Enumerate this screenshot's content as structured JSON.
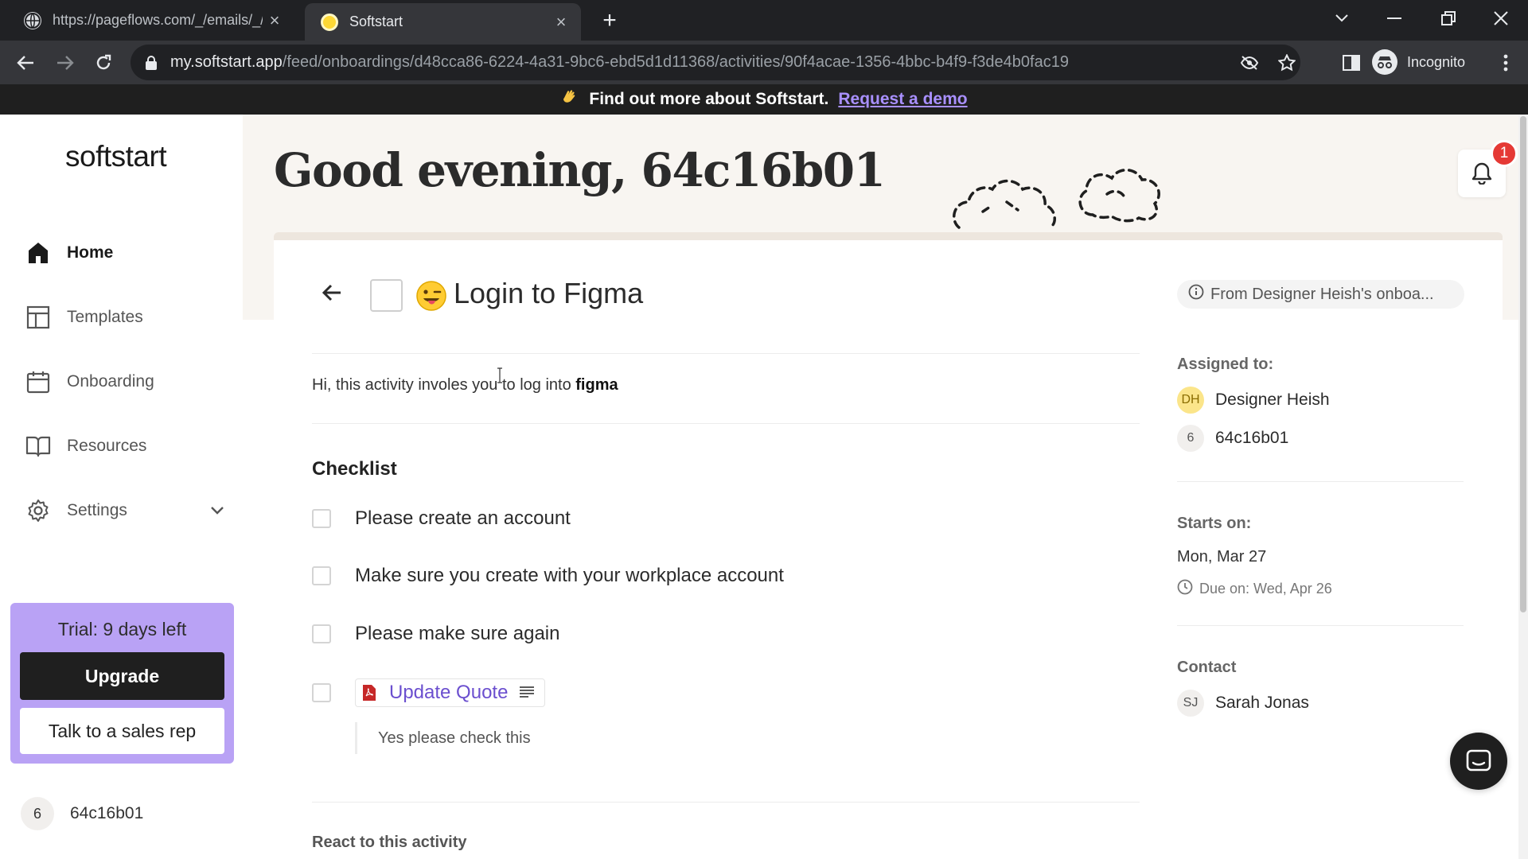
{
  "browser": {
    "tabs": [
      {
        "title": "https://pageflows.com/_/emails/_/",
        "active": false
      },
      {
        "title": "Softstart",
        "active": true
      }
    ],
    "url_host": "my.softstart.app",
    "url_path": "/feed/onboardings/d48cca86-6224-4a31-9bc6-ebd5d1d11368/activities/90f4acae-1356-4bbc-b4f9-f3de4b0fac19",
    "profile_label": "Incognito"
  },
  "banner": {
    "text": "Find out more about Softstart.",
    "link": "Request a demo"
  },
  "sidebar": {
    "logo": "softstart",
    "items": [
      {
        "label": "Home",
        "icon": "home-icon",
        "active": true
      },
      {
        "label": "Templates",
        "icon": "templates-icon",
        "active": false
      },
      {
        "label": "Onboarding",
        "icon": "calendar-icon",
        "active": false
      },
      {
        "label": "Resources",
        "icon": "book-icon",
        "active": false
      },
      {
        "label": "Settings",
        "icon": "gear-icon",
        "active": false
      }
    ],
    "trial": {
      "text": "Trial: 9 days left",
      "upgrade": "Upgrade",
      "sales": "Talk to a sales rep"
    },
    "user": {
      "avatar": "6",
      "name": "64c16b01"
    }
  },
  "header": {
    "greeting": "Good evening, 64c16b01",
    "notification_count": "1"
  },
  "activity": {
    "title": "Login to Figma",
    "emoji_icon": "winking-tongue-emoji",
    "from": "From Designer Heish's onboa...",
    "description_prefix": "Hi, this activity involes you to log into ",
    "description_bold": "figma",
    "checklist_title": "Checklist",
    "checklist": [
      "Please create an account",
      "Make sure you create with your workplace account",
      "Please make sure again"
    ],
    "file_item": {
      "name": "Update Quote",
      "note": "Yes please check this"
    },
    "react_label": "React to this activity"
  },
  "details": {
    "assigned_label": "Assigned to:",
    "assignees": [
      {
        "initials": "DH",
        "name": "Designer Heish"
      },
      {
        "initials": "6",
        "name": "64c16b01"
      }
    ],
    "starts_label": "Starts on:",
    "starts_value": "Mon, Mar 27",
    "due": "Due on: Wed, Apr 26",
    "contact_label": "Contact",
    "contact": {
      "initials": "SJ",
      "name": "Sarah Jonas"
    }
  },
  "colors": {
    "accent": "#b9a2f5",
    "link": "#6b4fcf",
    "header_bg": "#f8f5f1",
    "badge": "#e53935"
  }
}
